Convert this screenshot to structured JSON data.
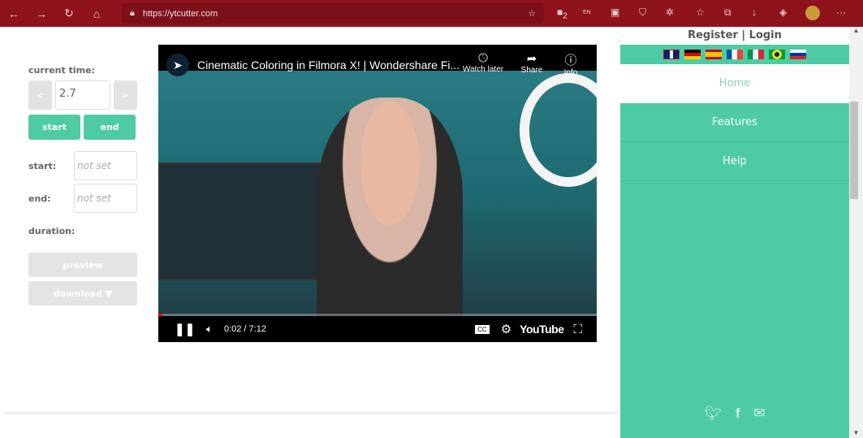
{
  "browser": {
    "url": "https://ytcutter.com",
    "nav_icons": [
      "back-icon",
      "forward-icon",
      "refresh-icon",
      "home-icon"
    ],
    "extension_badge": "2",
    "extension_label": "EN"
  },
  "controls": {
    "current_time_label": "current time:",
    "prev": "<",
    "next": ">",
    "current_time_value": "2.7",
    "start_btn": "start",
    "end_btn": "end",
    "start_label": "start:",
    "end_label": "end:",
    "start_placeholder": "not set",
    "end_placeholder": "not set",
    "duration_label": "duration:",
    "preview_btn": "preview",
    "download_btn": "download ▼"
  },
  "video": {
    "title": "Cinematic Coloring in Filmora X! | Wondershare Fi...",
    "watch_later": "Watch later",
    "share": "Share",
    "info": "Info",
    "time": "0:02 / 7:12",
    "brand": "YouTube",
    "progress": 0.005
  },
  "sidebar": {
    "register_login": "Register | Login",
    "flags": [
      "uk",
      "de",
      "es",
      "fr",
      "it",
      "br",
      "ru"
    ],
    "menu": [
      {
        "label": "Home",
        "active": true
      },
      {
        "label": "Features"
      },
      {
        "label": "Help"
      }
    ],
    "social": [
      "twitter-icon",
      "facebook-icon",
      "email-icon"
    ]
  },
  "colors": {
    "accent": "#4ecba5",
    "browser": "#8e131c"
  }
}
